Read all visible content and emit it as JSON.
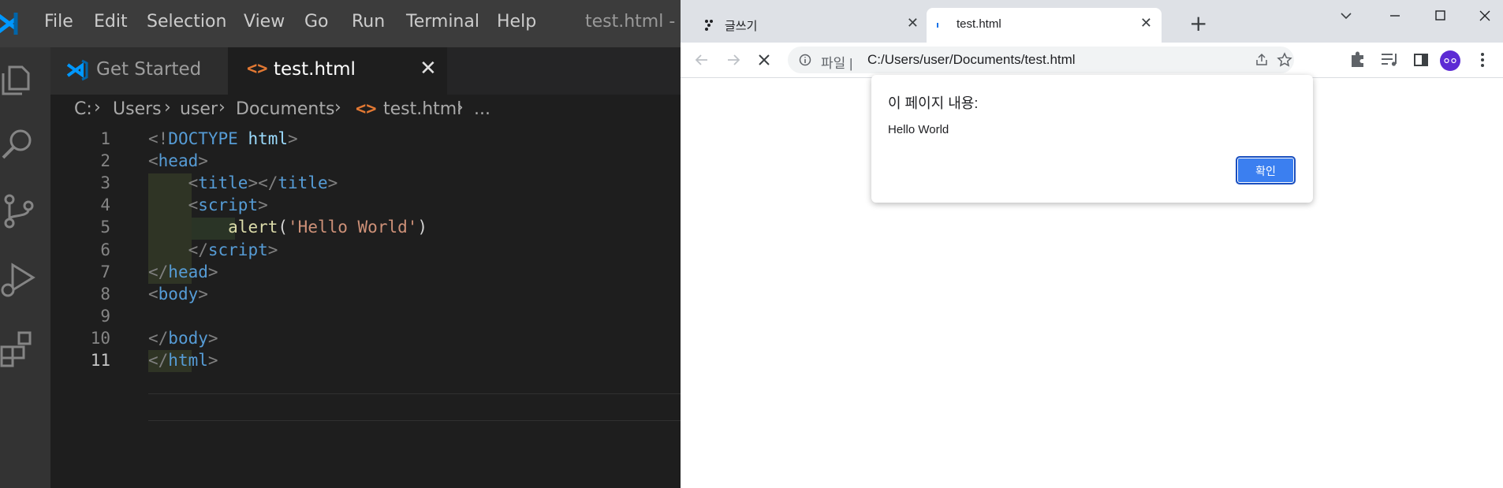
{
  "vscode": {
    "menu": [
      "File",
      "Edit",
      "Selection",
      "View",
      "Go",
      "Run",
      "Terminal",
      "Help"
    ],
    "window_title": "test.html - Vi",
    "tabs": [
      {
        "label": "Get Started",
        "active": false
      },
      {
        "label": "test.html",
        "active": true
      }
    ],
    "breadcrumb": [
      "C:",
      "Users",
      "user",
      "Documents",
      "test.html",
      "..."
    ],
    "line_numbers": [
      "1",
      "2",
      "3",
      "4",
      "5",
      "6",
      "7",
      "8",
      "9",
      "10",
      "11"
    ],
    "active_line": "11",
    "code": {
      "l1": {
        "open": "<!",
        "doctype": "DOCTYPE",
        "name": "html",
        "close": ">"
      },
      "l2": {
        "open": "<",
        "tag": "head",
        "close": ">"
      },
      "l3": {
        "open1": "<",
        "tag1": "title",
        "close1": "></",
        "tag2": "title",
        "close2": ">"
      },
      "l4": {
        "open": "<",
        "tag": "script",
        "close": ">"
      },
      "l5": {
        "fn": "alert",
        "paren_open": "(",
        "str": "'Hello World'",
        "paren_close": ")"
      },
      "l6": {
        "open": "</",
        "tag": "script",
        "close": ">"
      },
      "l7": {
        "open": "</",
        "tag": "head",
        "close": ">"
      },
      "l8": {
        "open": "<",
        "tag": "body",
        "close": ">"
      },
      "l10": {
        "open": "</",
        "tag": "body",
        "close": ">"
      },
      "l11": {
        "open": "</",
        "tag": "html",
        "close": ">"
      }
    },
    "colors": {
      "menubar": "#3c3c3c",
      "editor_bg": "#1e1e1e",
      "activity_bar": "#333333",
      "tag": "#569cd6",
      "string": "#ce9178",
      "function": "#dcdcaa"
    }
  },
  "chrome": {
    "tabs": [
      {
        "title": "글쓰기",
        "close": "✕"
      },
      {
        "title": "test.html",
        "close": "✕"
      }
    ],
    "new_tab": "+",
    "address": {
      "scheme_label": "파일",
      "separator": "|",
      "url": "C:/Users/user/Documents/test.html"
    },
    "dialog": {
      "title": "이 페이지 내용:",
      "message": "Hello World",
      "ok_label": "확인"
    },
    "colors": {
      "tabstrip": "#dee1e6",
      "button": "#3b7ff0",
      "avatar": "#5c2bd4"
    }
  }
}
